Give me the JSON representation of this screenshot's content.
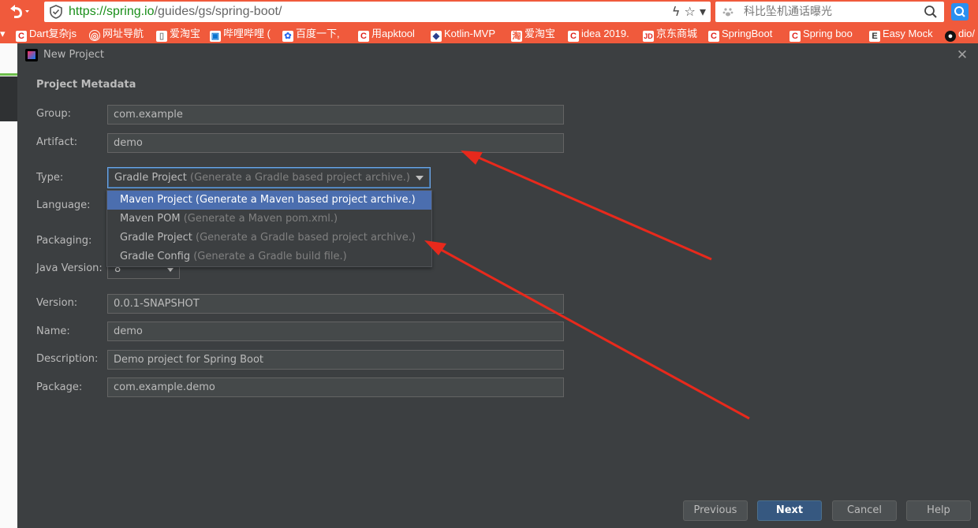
{
  "browser": {
    "url_scheme": "https://",
    "url_domain": "spring.io",
    "url_path": "/guides/gs/spring-boot/",
    "search_placeholder": "科比坠机通话曝光",
    "url_tools": "ϟ ☆ ▾"
  },
  "bookmarks": [
    {
      "label": "Dart复杂js",
      "icon": "C"
    },
    {
      "label": "网址导航",
      "icon": "◎"
    },
    {
      "label": "爱淘宝",
      "icon": "▯"
    },
    {
      "label": "哔哩哔哩 (",
      "icon": "▣"
    },
    {
      "label": "百度一下,",
      "icon": "✿"
    },
    {
      "label": "用apktool",
      "icon": "C"
    },
    {
      "label": "Kotlin-MVP",
      "icon": "◆"
    },
    {
      "label": "爱淘宝",
      "icon": "淘"
    },
    {
      "label": "idea 2019.",
      "icon": "C"
    },
    {
      "label": "京东商城",
      "icon": "JD"
    },
    {
      "label": "SpringBoot",
      "icon": "C"
    },
    {
      "label": "Spring boo",
      "icon": "C"
    },
    {
      "label": "Easy Mock",
      "icon": "E"
    },
    {
      "label": "dio/",
      "icon": "●"
    }
  ],
  "dialog": {
    "title": "New Project",
    "section_title": "Project Metadata",
    "labels": {
      "group": "Group:",
      "artifact": "Artifact:",
      "type": "Type:",
      "language": "Language:",
      "packaging": "Packaging:",
      "java_version": "Java Version:",
      "version": "Version:",
      "name": "Name:",
      "description": "Description:",
      "package": "Package:"
    },
    "values": {
      "group": "com.example",
      "artifact": "demo",
      "type_main": "Gradle Project",
      "type_hint": "(Generate a Gradle based project archive.)",
      "java_version": "8",
      "version": "0.0.1-SNAPSHOT",
      "name": "demo",
      "description": "Demo project for Spring Boot",
      "package": "com.example.demo"
    },
    "type_options": [
      {
        "main": "Maven Project",
        "hint": "(Generate a Maven based project archive.)",
        "selected": true
      },
      {
        "main": "Maven POM",
        "hint": "(Generate a Maven pom.xml.)",
        "selected": false
      },
      {
        "main": "Gradle Project",
        "hint": "(Generate a Gradle based project archive.)",
        "selected": false
      },
      {
        "main": "Gradle Config",
        "hint": "(Generate a Gradle build file.)",
        "selected": false
      }
    ],
    "buttons": {
      "previous": "Previous",
      "next": "Next",
      "cancel": "Cancel",
      "help": "Help"
    }
  },
  "colors": {
    "browser_bar": "#f05a3c",
    "dialog_bg": "#3c3f41",
    "selection": "#4b6eaf",
    "primary_button": "#365880",
    "annotation_arrow": "#e8291c"
  }
}
